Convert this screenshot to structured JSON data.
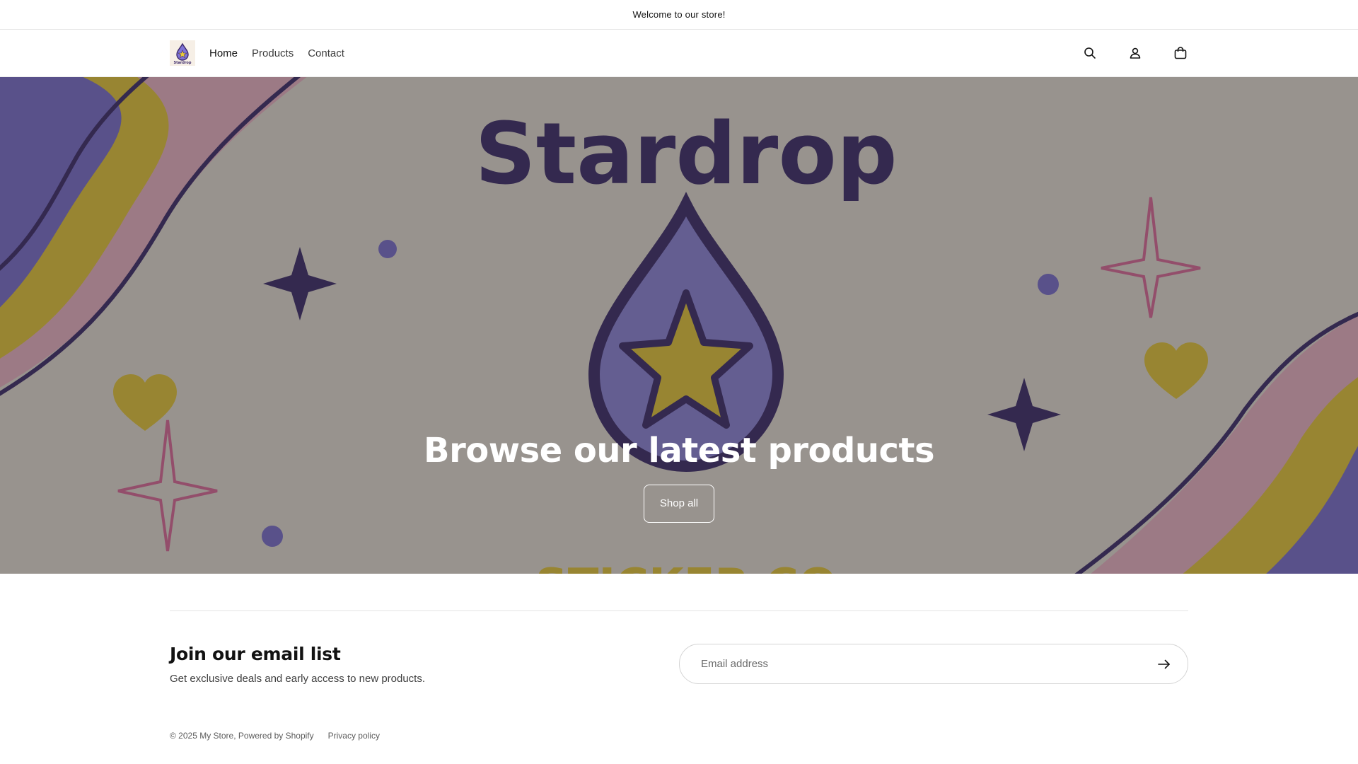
{
  "announcement": {
    "text": "Welcome to our store!"
  },
  "header": {
    "logo_text": "Stardrop",
    "nav": [
      {
        "label": "Home",
        "active": true
      },
      {
        "label": "Products",
        "active": false
      },
      {
        "label": "Contact",
        "active": false
      }
    ],
    "icons": [
      "search-icon",
      "account-icon",
      "cart-icon"
    ]
  },
  "hero": {
    "image_text_top": "Stardrop",
    "image_text_bottom": "STICKER CO",
    "title": "Browse our latest products",
    "button_label": "Shop all"
  },
  "newsletter": {
    "heading": "Join our email list",
    "subtext": "Get exclusive deals and early access to new products.",
    "email_placeholder": "Email address"
  },
  "footer": {
    "copyright": "© 2025 My Store, Powered by Shopify",
    "privacy_label": "Privacy policy"
  },
  "colors": {
    "brand_purple": "#3d2a6b",
    "brand_lavender": "#7f74d6",
    "brand_yellow": "#e8c93a",
    "brand_pink": "#e06a9c"
  }
}
